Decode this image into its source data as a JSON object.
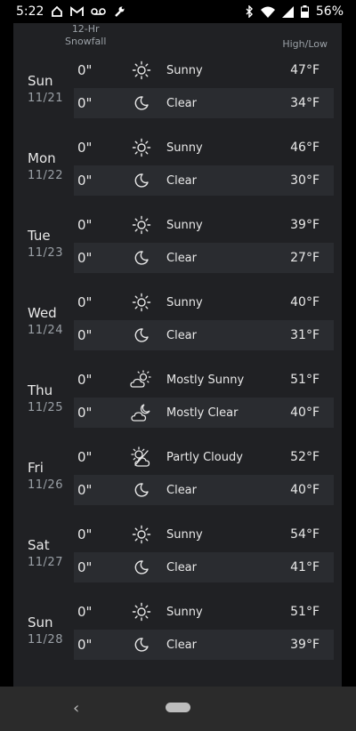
{
  "status_bar": {
    "time": "5:22",
    "battery": "56%",
    "icons_left": [
      "home-icon",
      "gmail-icon",
      "voicemail-icon",
      "wrench-icon"
    ],
    "icons_right": [
      "bluetooth-icon",
      "wifi-icon",
      "signal-icon",
      "battery-icon"
    ]
  },
  "header": {
    "snowfall_line1": "12-Hr",
    "snowfall_line2": "Snowfall",
    "high_low": "High/Low"
  },
  "days": [
    {
      "day": "Sun",
      "date": "11/21",
      "day_period": {
        "snow": "0\"",
        "icon": "sun-icon",
        "condition": "Sunny",
        "temp": "47°F"
      },
      "night_period": {
        "snow": "0\"",
        "icon": "moon-icon",
        "condition": "Clear",
        "temp": "34°F"
      }
    },
    {
      "day": "Mon",
      "date": "11/22",
      "day_period": {
        "snow": "0\"",
        "icon": "sun-icon",
        "condition": "Sunny",
        "temp": "46°F"
      },
      "night_period": {
        "snow": "0\"",
        "icon": "moon-icon",
        "condition": "Clear",
        "temp": "30°F"
      }
    },
    {
      "day": "Tue",
      "date": "11/23",
      "day_period": {
        "snow": "0\"",
        "icon": "sun-icon",
        "condition": "Sunny",
        "temp": "39°F"
      },
      "night_period": {
        "snow": "0\"",
        "icon": "moon-icon",
        "condition": "Clear",
        "temp": "27°F"
      }
    },
    {
      "day": "Wed",
      "date": "11/24",
      "day_period": {
        "snow": "0\"",
        "icon": "sun-icon",
        "condition": "Sunny",
        "temp": "40°F"
      },
      "night_period": {
        "snow": "0\"",
        "icon": "moon-icon",
        "condition": "Clear",
        "temp": "31°F"
      }
    },
    {
      "day": "Thu",
      "date": "11/25",
      "day_period": {
        "snow": "0\"",
        "icon": "sun-cloud-icon",
        "condition": "Mostly Sunny",
        "temp": "51°F"
      },
      "night_period": {
        "snow": "0\"",
        "icon": "moon-cloud-icon",
        "condition": "Mostly Clear",
        "temp": "40°F"
      }
    },
    {
      "day": "Fri",
      "date": "11/26",
      "day_period": {
        "snow": "0\"",
        "icon": "partly-cloudy-icon",
        "condition": "Partly Cloudy",
        "temp": "52°F"
      },
      "night_period": {
        "snow": "0\"",
        "icon": "moon-icon",
        "condition": "Clear",
        "temp": "40°F"
      }
    },
    {
      "day": "Sat",
      "date": "11/27",
      "day_period": {
        "snow": "0\"",
        "icon": "sun-icon",
        "condition": "Sunny",
        "temp": "54°F"
      },
      "night_period": {
        "snow": "0\"",
        "icon": "moon-icon",
        "condition": "Clear",
        "temp": "41°F"
      }
    },
    {
      "day": "Sun",
      "date": "11/28",
      "day_period": {
        "snow": "0\"",
        "icon": "sun-icon",
        "condition": "Sunny",
        "temp": "51°F"
      },
      "night_period": {
        "snow": "0\"",
        "icon": "moon-icon",
        "condition": "Clear",
        "temp": "39°F"
      }
    }
  ],
  "nav_bar": {
    "back_icon": "back-chevron-icon",
    "home_icon": "home-pill-icon"
  },
  "colors": {
    "panel": "#202124",
    "night_row": "#2a2c30",
    "text": "#e8e8e8",
    "muted": "#9aa0a6"
  }
}
